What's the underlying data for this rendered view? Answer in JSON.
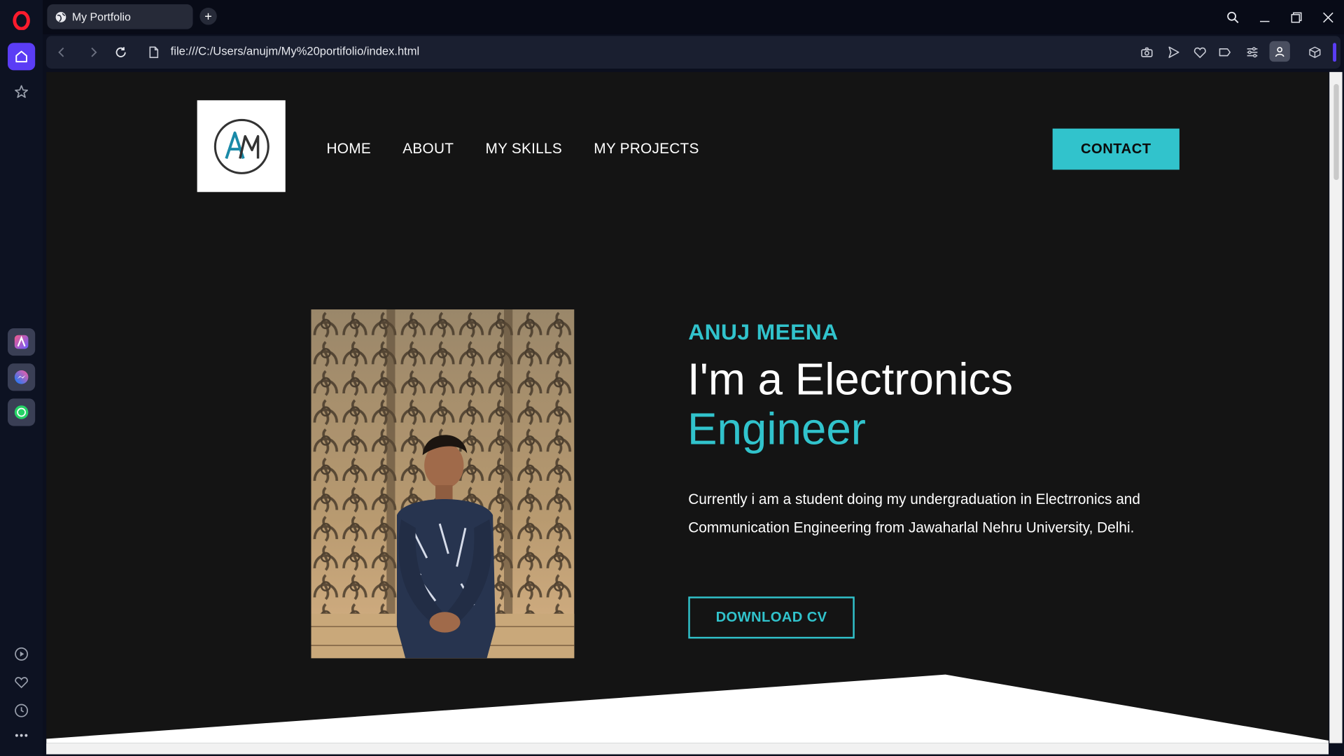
{
  "browser": {
    "tab_title": "My Portfolio",
    "new_tab_label": "+",
    "url": "file:///C:/Users/anujm/My%20portifolio/index.html"
  },
  "sidebar": {
    "items": [
      {
        "icon": "home-icon"
      },
      {
        "icon": "star-icon"
      },
      {
        "icon": "aria-icon"
      },
      {
        "icon": "messenger-icon"
      },
      {
        "icon": "whatsapp-icon"
      },
      {
        "icon": "player-icon"
      },
      {
        "icon": "heart-icon"
      },
      {
        "icon": "history-icon"
      },
      {
        "icon": "more-icon"
      }
    ]
  },
  "page": {
    "logo_text": "AM",
    "nav": [
      "HOME",
      "ABOUT",
      "MY SKILLS",
      "MY PROJECTS"
    ],
    "contact_label": "CONTACT",
    "name": "ANUJ MEENA",
    "headline_line1": "I'm a Electronics",
    "headline_line2": "Engineer",
    "description": "Currently i am a student doing my undergraduation in Electrronics and Communication Engineering from Jawaharlal Nehru University, Delhi.",
    "download_label": "DOWNLOAD CV"
  },
  "colors": {
    "accent": "#31c3cc",
    "page_bg": "#141414",
    "browser_bg": "#0b0f1e",
    "sidebar_active": "#5b3df5"
  }
}
